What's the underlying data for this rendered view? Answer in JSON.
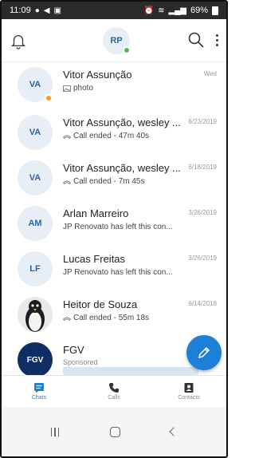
{
  "status_bar": {
    "time": "11:09",
    "battery": "69%"
  },
  "header": {
    "user_initials": "RP"
  },
  "chats": [
    {
      "initials": "VA",
      "name": "Vitor Assunção",
      "date": "Wed",
      "subtitle": "photo",
      "sub_icon": "image-icon",
      "status": "away"
    },
    {
      "initials": "VA",
      "name": "Vitor Assunção, wesley ...",
      "date": "6/23/2019",
      "subtitle": "Call ended - 47m 40s",
      "sub_icon": "call-ended-icon"
    },
    {
      "initials": "VA",
      "name": "Vitor Assunção, wesley ...",
      "date": "6/18/2019",
      "subtitle": "Call ended - 7m 45s",
      "sub_icon": "call-ended-icon"
    },
    {
      "initials": "AM",
      "name": "Arlan Marreiro",
      "date": "3/26/2019",
      "subtitle": "JP Renovato has left this con..."
    },
    {
      "initials": "LF",
      "name": "Lucas Freitas",
      "date": "3/26/2019",
      "subtitle": "JP Renovato has left this con..."
    },
    {
      "initials": "",
      "name": "Heitor de Souza",
      "date": "6/14/2018",
      "subtitle": "Call ended - 55m 18s",
      "sub_icon": "call-ended-icon"
    }
  ],
  "ad": {
    "logo_text": "FGV",
    "name": "FGV",
    "sponsored": "Sponsored"
  },
  "tabs": [
    {
      "label": "Chats",
      "icon": "chat-icon",
      "active": true
    },
    {
      "label": "Calls",
      "icon": "phone-icon",
      "active": false
    },
    {
      "label": "Contacts",
      "icon": "contacts-icon",
      "active": false
    }
  ],
  "colors": {
    "accent": "#1e7fd6",
    "avatar_bg": "#e8eef6",
    "avatar_text": "#2c64a6",
    "online": "#4bbf4b",
    "away": "#f0a418"
  }
}
